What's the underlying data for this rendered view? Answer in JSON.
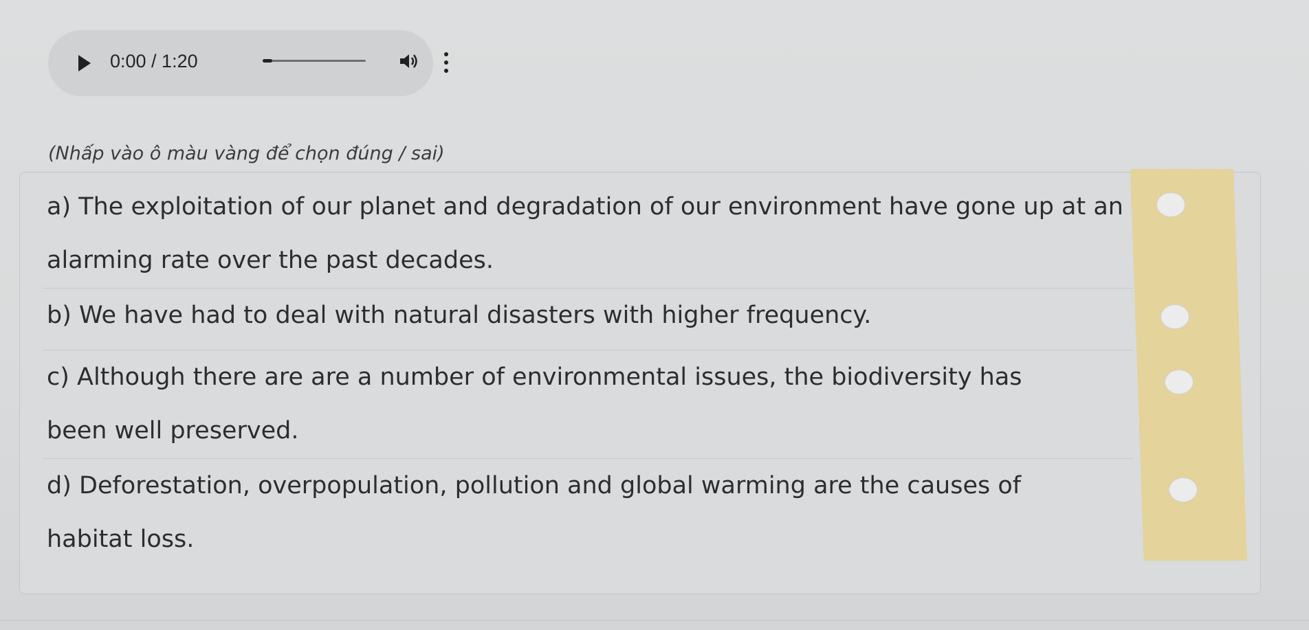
{
  "audio": {
    "current_time": "0:00",
    "duration": "1:20",
    "time_text": "0:00 / 1:20",
    "progress_fraction": 0.0
  },
  "instruction": "(Nhấp vào ô màu vàng để chọn đúng / sai)",
  "statements": [
    {
      "text": "a) The exploitation of our planet and degradation of our environment have gone up at an alarming rate over the past decades."
    },
    {
      "text": "b) We have had to deal with natural disasters with higher frequency."
    },
    {
      "text": "c) Although there are are a number of environmental issues, the biodiversity has been well preserved."
    },
    {
      "text": "d) Deforestation, overpopulation, pollution and global warming are the causes of habitat loss."
    }
  ],
  "colors": {
    "answer_column": "#e4d39a",
    "choice_circle": "#ececec",
    "background": "#dcdedf"
  },
  "icons": {
    "play": "play-icon",
    "volume": "volume-icon",
    "more": "more-vertical-icon"
  }
}
